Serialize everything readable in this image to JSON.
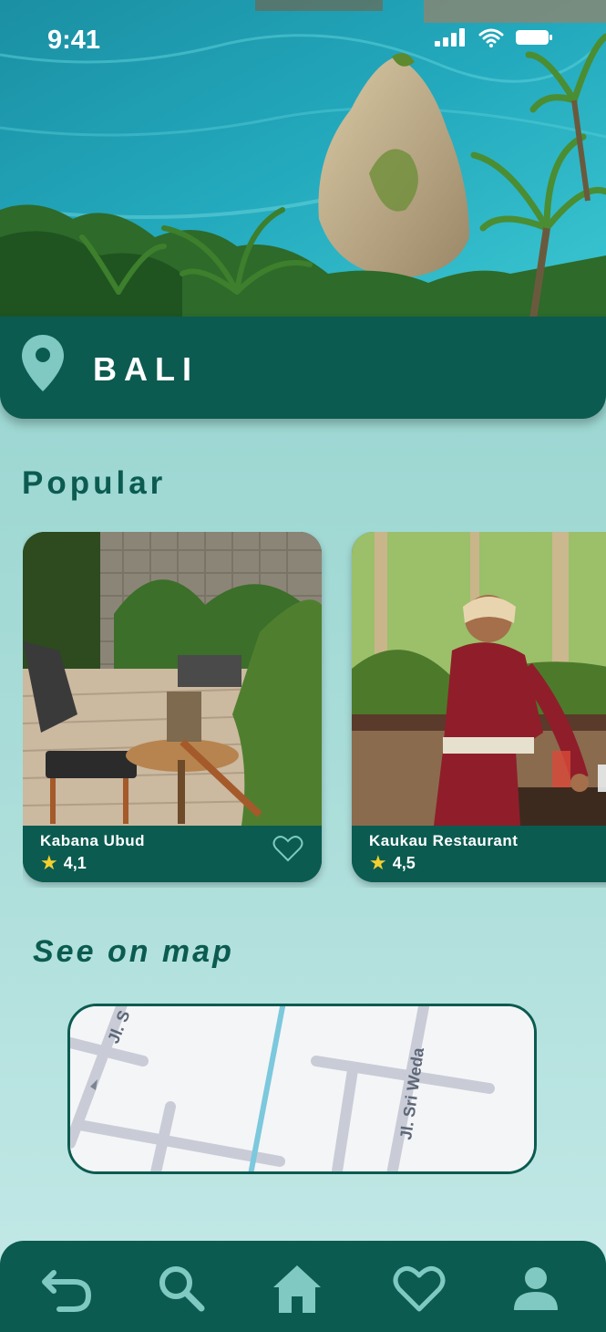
{
  "status_bar": {
    "time": "9:41"
  },
  "location": {
    "city": "BALI",
    "icon": "location-pin-icon"
  },
  "popular": {
    "title": "Popular",
    "cards": [
      {
        "name": "Kabana Ubud",
        "rating": "4,1",
        "rating_icon": "star-icon",
        "favorite_icon": "heart-outline-icon"
      },
      {
        "name": "Kaukau Restaurant",
        "rating": "4,5",
        "rating_icon": "star-icon",
        "favorite_icon": "heart-outline-icon"
      }
    ]
  },
  "map": {
    "title": "See on map",
    "street_labels": [
      "Jl. S",
      "Jl. Sri Weda"
    ]
  },
  "bottom_nav": {
    "items": [
      {
        "name": "back",
        "icon": "back-arrow-icon"
      },
      {
        "name": "search",
        "icon": "search-icon"
      },
      {
        "name": "home",
        "icon": "home-icon"
      },
      {
        "name": "favorites",
        "icon": "heart-icon"
      },
      {
        "name": "profile",
        "icon": "user-icon"
      }
    ]
  },
  "colors": {
    "primary": "#0b5b50",
    "accent_light": "#8fd0cb",
    "icon_tint": "#7fc9c2",
    "star": "#f4d02e"
  }
}
